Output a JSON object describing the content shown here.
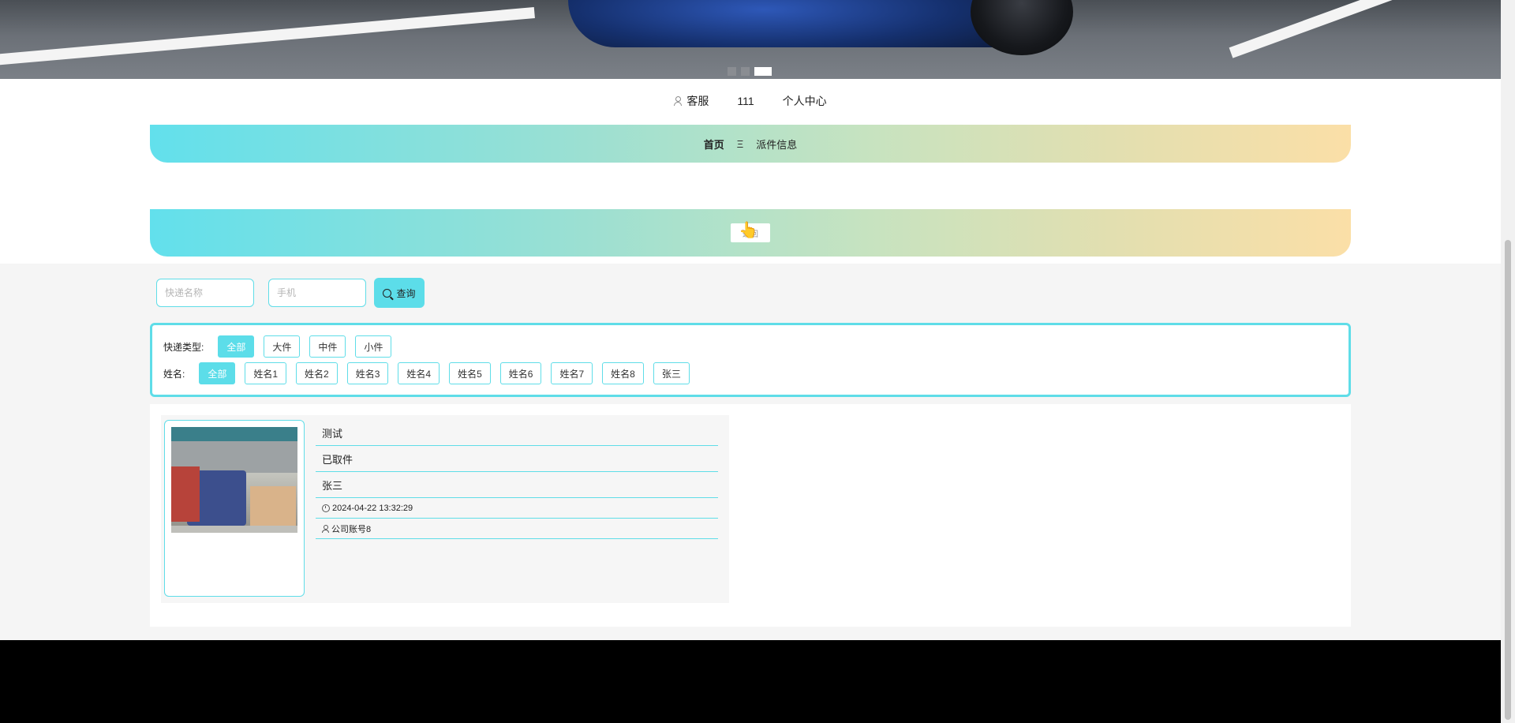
{
  "carousel": {
    "dot_count": 3,
    "active_index": 2
  },
  "toplinks": {
    "service": "客服",
    "username": "111",
    "profile": "个人中心"
  },
  "breadcrumb": {
    "home": "首页",
    "separator": "Ξ",
    "current": "派件信息"
  },
  "banner_button": {
    "label": "返回"
  },
  "search": {
    "name_placeholder": "快递名称",
    "phone_placeholder": "手机",
    "query_label": "查询"
  },
  "filters": {
    "type_label": "快递类型:",
    "type_options": [
      "全部",
      "大件",
      "中件",
      "小件"
    ],
    "type_selected": 0,
    "name_label": "姓名:",
    "name_options": [
      "全部",
      "姓名1",
      "姓名2",
      "姓名3",
      "姓名4",
      "姓名5",
      "姓名6",
      "姓名7",
      "姓名8",
      "张三"
    ],
    "name_selected": 0
  },
  "items": [
    {
      "title": "测试",
      "status": "已取件",
      "name": "张三",
      "time": "2024-04-22 13:32:29",
      "account": "公司账号8"
    }
  ]
}
